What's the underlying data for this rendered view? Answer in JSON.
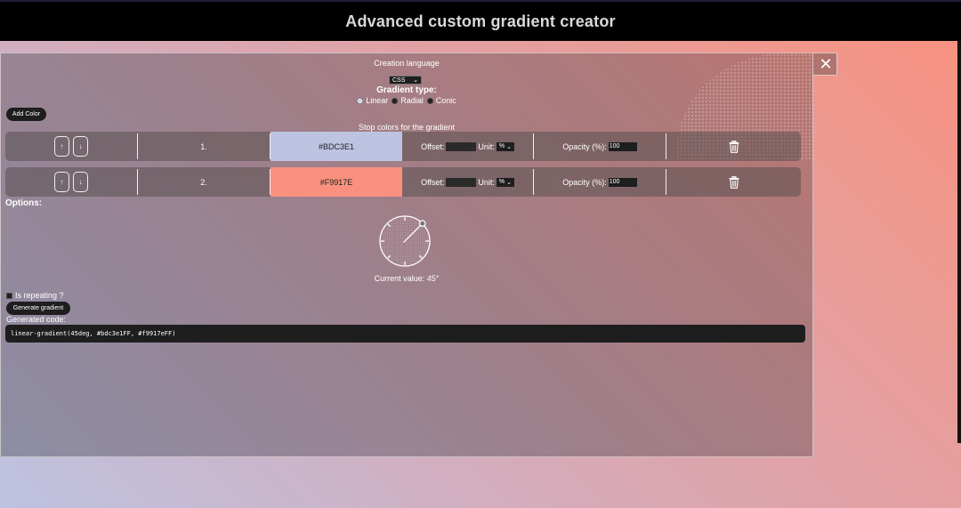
{
  "header": {
    "title": "Advanced custom gradient creator"
  },
  "language": {
    "label": "Creation language",
    "selected": "CSS"
  },
  "gradient_type": {
    "label": "Gradient type:",
    "options": [
      {
        "label": "Linear",
        "checked": true
      },
      {
        "label": "Radial",
        "checked": false
      },
      {
        "label": "Conic",
        "checked": false
      }
    ]
  },
  "add_color_label": "Add Color",
  "stops_label": "Stop colors for the gradient",
  "stops": [
    {
      "index": "1.",
      "color": "#BDC3E1",
      "offset_label": "Offset:",
      "offset_value": "",
      "unit_label": "Unit:",
      "unit": "%",
      "opacity_label": "Opacity (%):",
      "opacity": "100",
      "up": "↑",
      "down": "↓"
    },
    {
      "index": "2.",
      "color": "#F9917E",
      "offset_label": "Offset:",
      "offset_value": "",
      "unit_label": "Unit:",
      "unit": "%",
      "opacity_label": "Opacity (%):",
      "opacity": "100",
      "up": "↑",
      "down": "↓"
    }
  ],
  "options_label": "Options:",
  "angle": {
    "value": 45,
    "current_label": "Current value: 45°"
  },
  "repeating_label": "Is repeating ?",
  "generate_label": "Generate gradient",
  "generated_code_label": "Generated code:",
  "generated_code": "linear-gradient(45deg, #bdc3e1FF, #f9917eFF)",
  "icons": {
    "close": "close-icon",
    "delete": "trash-icon",
    "dropdown": "chevron-down-icon"
  }
}
